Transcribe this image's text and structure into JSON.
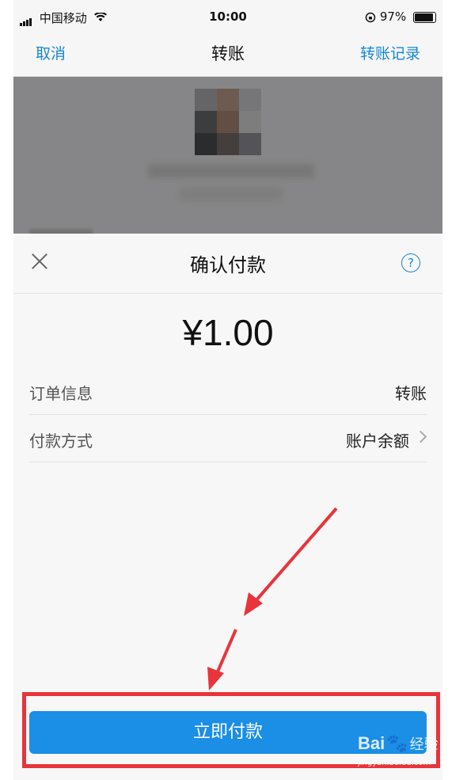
{
  "status_bar": {
    "carrier": "中国移动",
    "time": "10:00",
    "battery_percent": "97%"
  },
  "nav": {
    "cancel_label": "取消",
    "title": "转账",
    "records_label": "转账记录"
  },
  "sheet": {
    "title": "确认付款",
    "help_label": "?",
    "amount": "¥1.00",
    "rows": [
      {
        "label": "订单信息",
        "value": "转账"
      },
      {
        "label": "付款方式",
        "value": "账户余额"
      }
    ],
    "pay_button_label": "立即付款"
  },
  "watermark": {
    "brand": "Bai",
    "brand_suffix": "经验",
    "url": "jingyan.baidu.com"
  },
  "colors": {
    "accent": "#1786d8",
    "button": "#1b8ee6",
    "annotation": "#e8343a"
  },
  "icons": [
    "wifi-icon",
    "lock-rotation-icon",
    "battery-icon",
    "close-icon",
    "help-icon",
    "chevron-right-icon"
  ]
}
